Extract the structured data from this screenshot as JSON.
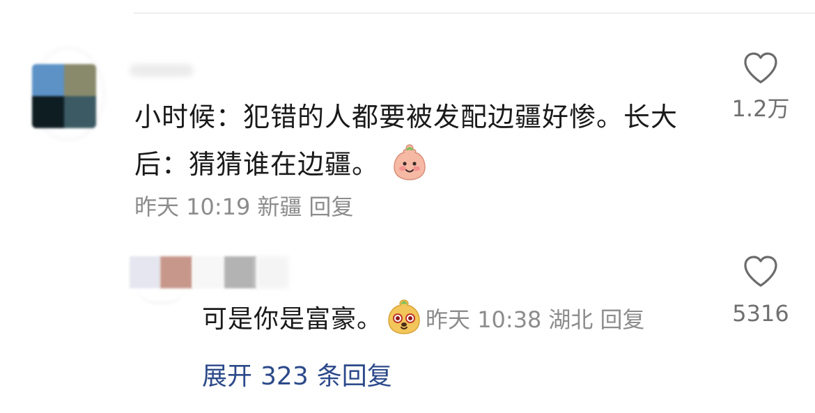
{
  "comment": {
    "text": "小时候：犯错的人都要被发配边疆好惨。长大后：猜猜谁在边疆。",
    "emoji_icon": "smiling-face-emoji",
    "time": "昨天 10:19",
    "location": "新疆",
    "reply_label": "回复",
    "like_icon": "heart-icon",
    "like_count": "1.2万"
  },
  "reply": {
    "text": "可是你是富豪。",
    "emoji_icon": "puppy-face-emoji",
    "time": "昨天 10:38",
    "location": "湖北",
    "reply_label": "回复",
    "like_icon": "heart-icon",
    "like_count": "5316"
  },
  "expand": {
    "label_prefix": "展开",
    "count": "323",
    "label_suffix": "条回复"
  },
  "colors": {
    "text_primary": "#1a1a1a",
    "text_secondary": "#8c8c8c",
    "link": "#2c4a8a"
  }
}
